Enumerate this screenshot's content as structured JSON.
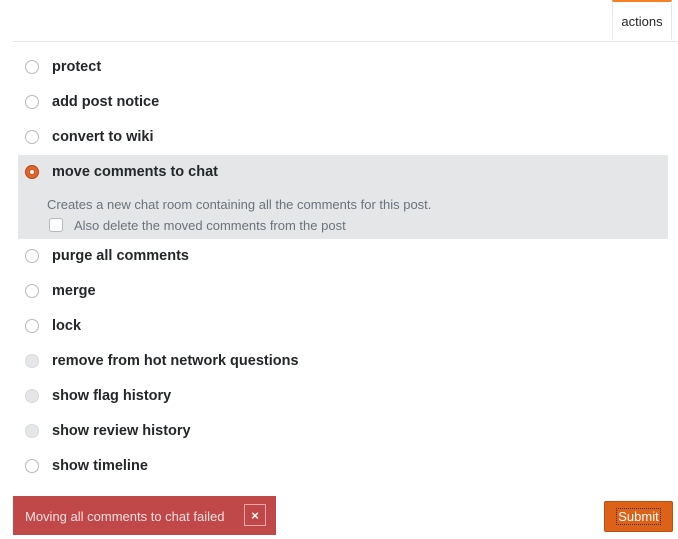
{
  "tabs": {
    "active_label": "actions"
  },
  "options": [
    {
      "label": "protect",
      "state": "enabled"
    },
    {
      "label": "add post notice",
      "state": "enabled"
    },
    {
      "label": "convert to wiki",
      "state": "enabled"
    },
    {
      "label": "move comments to chat",
      "state": "selected",
      "description": "Creates a new chat room containing all the comments for this post.",
      "checkbox_label": "Also delete the moved comments from the post",
      "checkbox_checked": false
    },
    {
      "label": "purge all comments",
      "state": "enabled"
    },
    {
      "label": "merge",
      "state": "enabled"
    },
    {
      "label": "lock",
      "state": "enabled"
    },
    {
      "label": "remove from hot network questions",
      "state": "disabled"
    },
    {
      "label": "show flag history",
      "state": "disabled"
    },
    {
      "label": "show review history",
      "state": "disabled"
    },
    {
      "label": "show timeline",
      "state": "enabled"
    }
  ],
  "toast": {
    "message": "Moving all comments to chat failed",
    "close_glyph": "×"
  },
  "submit_label": "Submit",
  "colors": {
    "accent": "#f48024",
    "selected_radio": "#d4561e",
    "toast_bg": "#c04848",
    "submit_bg": "#dd6116"
  }
}
